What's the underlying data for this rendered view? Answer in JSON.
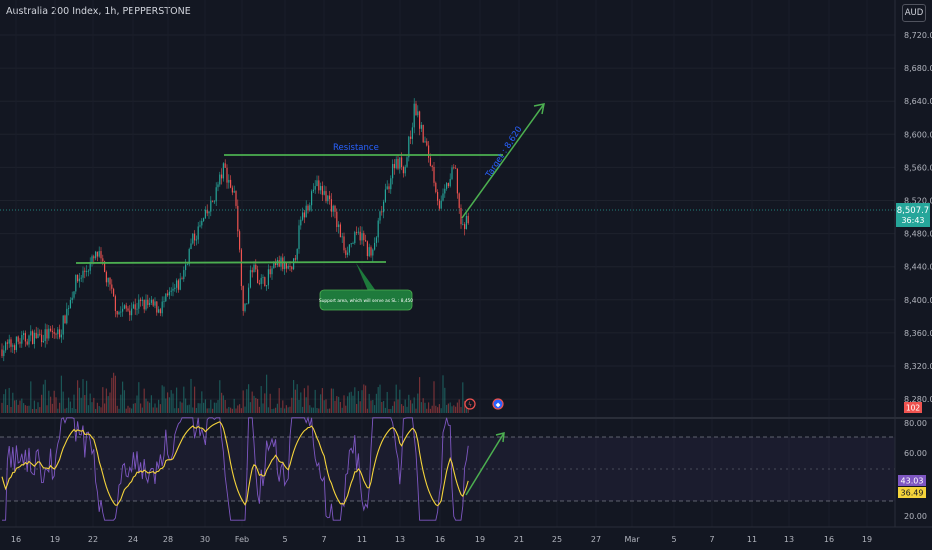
{
  "header": {
    "title": "Australia 200 Index, 1h, PEPPERSTONE",
    "currency": "AUD"
  },
  "price_axis": {
    "labels": [
      "8,720.0",
      "8,680.0",
      "8,640.0",
      "8,600.0",
      "8,560.0",
      "8,520.0",
      "8,480.0",
      "8,440.0",
      "8,400.0",
      "8,360.0",
      "8,320.0",
      "8,280.0"
    ],
    "last_price": "8,507.7",
    "countdown": "36:43",
    "volume_tag": "102"
  },
  "rsi_axis": {
    "labels": [
      "80.00",
      "60.00",
      "20.00"
    ],
    "rsi_value": "43.03",
    "ma_value": "36.49"
  },
  "time_axis": [
    "16",
    "19",
    "22",
    "24",
    "28",
    "30",
    "Feb",
    "5",
    "7",
    "11",
    "13",
    "16",
    "19",
    "21",
    "25",
    "27",
    "Mar",
    "5",
    "7",
    "11",
    "13",
    "16",
    "19"
  ],
  "annotations": {
    "resistance": "Resistance",
    "target": "Target : 8,620",
    "support": "Support area, which will serve as SL : 8,450"
  },
  "colors": {
    "bg": "#131722",
    "up": "#26a69a",
    "down": "#ef5350",
    "level": "#4caf50",
    "rsi": "#7e57c2",
    "rsi_ma": "#f5d43b",
    "text": "#b2b5be"
  },
  "chart_data": {
    "type": "line",
    "description_series": "Price path (approximate closes)",
    "x": [
      "16",
      "19",
      "22",
      "24",
      "28",
      "30",
      "Feb",
      "5",
      "7",
      "11",
      "13",
      "16",
      "18"
    ],
    "price": [
      8330,
      8350,
      8440,
      8390,
      8450,
      8560,
      8440,
      8460,
      8540,
      8460,
      8570,
      8560,
      8507
    ],
    "ylim": [
      8270,
      8740
    ],
    "levels": {
      "resistance": 8570,
      "support": 8447
    },
    "rsi": {
      "ylim": [
        15,
        85
      ],
      "upper_band": 70,
      "lower_band": 30,
      "last": 43.03,
      "ma_last": 36.49
    }
  }
}
